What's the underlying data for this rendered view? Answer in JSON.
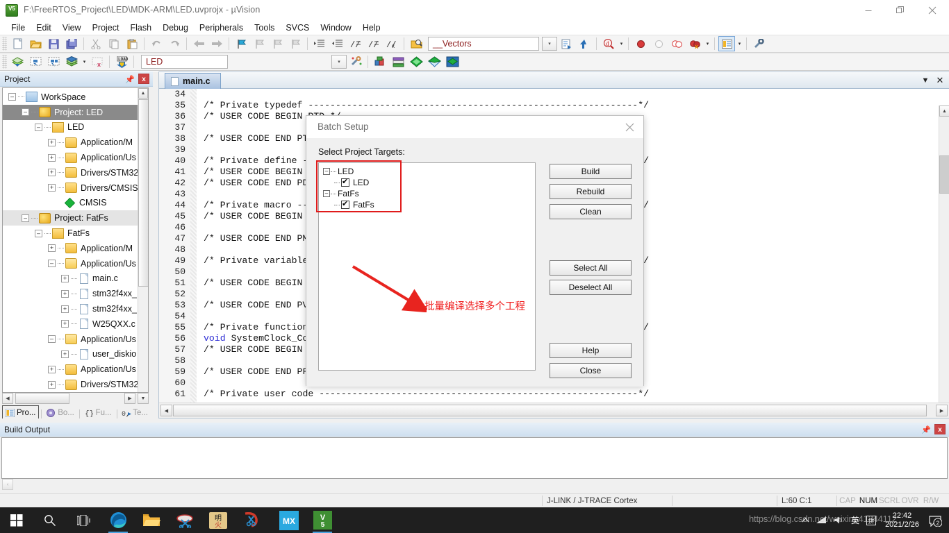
{
  "window": {
    "title": "F:\\FreeRTOS_Project\\LED\\MDK-ARM\\LED.uvprojx - µVision",
    "app_icon": "uvision-v5-icon",
    "minimize": "minimize-icon",
    "maximize": "restore-icon",
    "close": "close-icon"
  },
  "menu": {
    "items": [
      {
        "label": "File"
      },
      {
        "label": "Edit"
      },
      {
        "label": "View"
      },
      {
        "label": "Project"
      },
      {
        "label": "Flash"
      },
      {
        "label": "Debug"
      },
      {
        "label": "Peripherals"
      },
      {
        "label": "Tools"
      },
      {
        "label": "SVCS"
      },
      {
        "label": "Window"
      },
      {
        "label": "Help"
      }
    ]
  },
  "toolbar_main": {
    "icons": [
      "new-file-icon",
      "open-file-icon",
      "save-icon",
      "save-all-icon",
      "cut-icon",
      "copy-icon",
      "paste-icon",
      "undo-icon",
      "redo-icon",
      "navigate-back-icon",
      "navigate-forward-icon",
      "bookmark-toggle-icon",
      "bookmark-prev-icon",
      "bookmark-next-icon",
      "bookmark-clear-icon",
      "indent-icon",
      "outdent-icon",
      "comment-icon",
      "uncomment-icon",
      "find-in-files-icon"
    ],
    "vectors_combo": "__Vectors",
    "after_combo_icons": [
      "browse-symbol-icon",
      "goto-definition-icon",
      "find-next-icon",
      "insert-breakpoint-icon",
      "disable-breakpoint-icon",
      "disable-all-breakpoints-icon",
      "kill-all-breakpoints-icon",
      "manage-windows-icon",
      "configuration-wizard-icon"
    ]
  },
  "toolbar_build": {
    "icons": [
      "translate-icon",
      "build-icon",
      "rebuild-icon",
      "batch-build-icon",
      "stop-build-icon",
      "download-icon"
    ],
    "target_combo": "LED",
    "right_icons": [
      "target-options-icon",
      "manage-run-time-env-icon",
      "manage-project-items-icon",
      "multi-project-icon",
      "pack-installer-icon"
    ]
  },
  "project_panel": {
    "title": "Project",
    "pin_icon": "pin-icon",
    "close_icon": "close-icon",
    "tree": [
      {
        "label": "WorkSpace",
        "indent": 0,
        "icon": "workspace-icon",
        "expander": "-",
        "state": "normal"
      },
      {
        "label": "Project: LED",
        "indent": 1,
        "icon": "project-icon",
        "expander": "-",
        "state": "selected-dark"
      },
      {
        "label": "LED",
        "indent": 2,
        "icon": "target-icon",
        "expander": "-",
        "state": "normal"
      },
      {
        "label": "Application/M",
        "indent": 3,
        "icon": "folder-icon",
        "expander": "+",
        "state": "normal"
      },
      {
        "label": "Application/Us",
        "indent": 3,
        "icon": "folder-icon",
        "expander": "+",
        "state": "normal"
      },
      {
        "label": "Drivers/STM32",
        "indent": 3,
        "icon": "folder-icon",
        "expander": "+",
        "state": "normal"
      },
      {
        "label": "Drivers/CMSIS",
        "indent": 3,
        "icon": "folder-icon",
        "expander": "+",
        "state": "normal"
      },
      {
        "label": "CMSIS",
        "indent": 3,
        "icon": "cmsis-icon",
        "expander": "",
        "state": "normal"
      },
      {
        "label": "Project: FatFs",
        "indent": 1,
        "icon": "project-icon",
        "expander": "-",
        "state": "selected-light"
      },
      {
        "label": "FatFs",
        "indent": 2,
        "icon": "target-icon",
        "expander": "-",
        "state": "normal"
      },
      {
        "label": "Application/M",
        "indent": 3,
        "icon": "folder-icon",
        "expander": "+",
        "state": "normal"
      },
      {
        "label": "Application/Us",
        "indent": 3,
        "icon": "folder-open-icon",
        "expander": "-",
        "state": "normal"
      },
      {
        "label": "main.c",
        "indent": 4,
        "icon": "c-file-icon",
        "expander": "+",
        "state": "normal"
      },
      {
        "label": "stm32f4xx_",
        "indent": 4,
        "icon": "c-file-icon",
        "expander": "+",
        "state": "normal"
      },
      {
        "label": "stm32f4xx_",
        "indent": 4,
        "icon": "c-file-icon",
        "expander": "+",
        "state": "normal"
      },
      {
        "label": "W25QXX.c",
        "indent": 4,
        "icon": "c-file-icon",
        "expander": "+",
        "state": "normal"
      },
      {
        "label": "Application/Us",
        "indent": 3,
        "icon": "folder-open-icon",
        "expander": "-",
        "state": "normal"
      },
      {
        "label": "user_diskio",
        "indent": 4,
        "icon": "c-file-icon",
        "expander": "+",
        "state": "normal"
      },
      {
        "label": "Application/Us",
        "indent": 3,
        "icon": "folder-icon",
        "expander": "+",
        "state": "normal"
      },
      {
        "label": "Drivers/STM32",
        "indent": 3,
        "icon": "folder-icon",
        "expander": "+",
        "state": "normal"
      }
    ],
    "tabs": [
      {
        "label": "Pro...",
        "icon": "project-tab-icon",
        "active": true
      },
      {
        "label": "Bo...",
        "icon": "books-tab-icon",
        "active": false
      },
      {
        "label": "Fu...",
        "icon": "functions-tab-icon",
        "active": false
      },
      {
        "label": "Te...",
        "icon": "templates-tab-icon",
        "active": false
      }
    ]
  },
  "editor": {
    "tab": {
      "label": "main.c",
      "icon": "c-file-icon"
    },
    "dropdown_icon": "chevron-down-icon",
    "close_icon": "close-icon",
    "lines": [
      {
        "num": "34",
        "text": "",
        "cls": ""
      },
      {
        "num": "35",
        "text": "/* Private typedef ------------------------------------------------------------*/",
        "cls": "cmt"
      },
      {
        "num": "36",
        "text": "/* USER CODE BEGIN PTD */",
        "cls": "cmt"
      },
      {
        "num": "37",
        "text": "",
        "cls": ""
      },
      {
        "num": "38",
        "text": "/* USER CODE END PTD */",
        "cls": "cmt"
      },
      {
        "num": "39",
        "text": "",
        "cls": ""
      },
      {
        "num": "40",
        "text": "/* Private define -------------------------------------------------------------*/",
        "cls": "cmt"
      },
      {
        "num": "41",
        "text": "/* USER CODE BEGIN PD */",
        "cls": "cmt"
      },
      {
        "num": "42",
        "text": "/* USER CODE END PD */",
        "cls": "cmt"
      },
      {
        "num": "43",
        "text": "",
        "cls": ""
      },
      {
        "num": "44",
        "text": "/* Private macro --------------------------------------------------------------*/",
        "cls": "cmt"
      },
      {
        "num": "45",
        "text": "/* USER CODE BEGIN PM */",
        "cls": "cmt"
      },
      {
        "num": "46",
        "text": "",
        "cls": ""
      },
      {
        "num": "47",
        "text": "/* USER CODE END PM */",
        "cls": "cmt"
      },
      {
        "num": "48",
        "text": "",
        "cls": ""
      },
      {
        "num": "49",
        "text": "/* Private variables ----------------------------------------------------------*/",
        "cls": "cmt"
      },
      {
        "num": "50",
        "text": "",
        "cls": ""
      },
      {
        "num": "51",
        "text": "/* USER CODE BEGIN PV */",
        "cls": "cmt"
      },
      {
        "num": "52",
        "text": "",
        "cls": ""
      },
      {
        "num": "53",
        "text": "/* USER CODE END PV */",
        "cls": "cmt"
      },
      {
        "num": "54",
        "text": "",
        "cls": ""
      },
      {
        "num": "55",
        "text": "/* Private function prototypes ------------------------------------------------*/",
        "cls": "cmt"
      },
      {
        "num": "56",
        "text": "void SystemClock_Config(void);",
        "cls": "kwline"
      },
      {
        "num": "57",
        "text": "/* USER CODE BEGIN PFP */",
        "cls": "cmt"
      },
      {
        "num": "58",
        "text": "",
        "cls": ""
      },
      {
        "num": "59",
        "text": "/* USER CODE END PFP */",
        "cls": "cmt"
      },
      {
        "num": "60",
        "text": "",
        "cls": ""
      },
      {
        "num": "61",
        "text": "/* Private user code ----------------------------------------------------------*/",
        "cls": "cmt"
      }
    ]
  },
  "dialog": {
    "title": "Batch Setup",
    "close_icon": "close-icon",
    "label": "Select Project Targets:",
    "targets": [
      {
        "name": "LED",
        "type": "project",
        "expander": "-"
      },
      {
        "name": "LED",
        "type": "target",
        "checked": true
      },
      {
        "name": "FatFs",
        "type": "project",
        "expander": "-"
      },
      {
        "name": "FatFs",
        "type": "target",
        "checked": true
      }
    ],
    "annotation": "批量编译选择多个工程",
    "annotation_color": "#f01d1d",
    "buttons_top": [
      {
        "label": "Build"
      },
      {
        "label": "Rebuild"
      },
      {
        "label": "Clean"
      }
    ],
    "buttons_mid": [
      {
        "label": "Select All"
      },
      {
        "label": "Deselect All"
      }
    ],
    "buttons_bottom": [
      {
        "label": "Help"
      },
      {
        "label": "Close"
      }
    ]
  },
  "build_output": {
    "title": "Build Output",
    "pin_icon": "pin-icon",
    "close_icon": "close-icon",
    "content": ""
  },
  "statusbar": {
    "debugger": "J-LINK / J-TRACE Cortex",
    "cursor": "L:60 C:1",
    "flags": [
      {
        "label": "CAP",
        "on": false
      },
      {
        "label": "NUM",
        "on": true
      },
      {
        "label": "SCRL",
        "on": false
      },
      {
        "label": "OVR",
        "on": false
      },
      {
        "label": "R/W",
        "on": false
      }
    ]
  },
  "taskbar": {
    "items": [
      {
        "name": "start-button",
        "icon": "windows-logo-icon",
        "running": false
      },
      {
        "name": "search-button",
        "icon": "search-icon",
        "running": false
      },
      {
        "name": "task-view-button",
        "icon": "task-view-icon",
        "running": false
      },
      {
        "name": "edge-button",
        "icon": "edge-browser-icon",
        "running": true
      },
      {
        "name": "explorer-button",
        "icon": "file-explorer-icon",
        "running": false
      },
      {
        "name": "snipping-button",
        "icon": "snipping-tool-icon",
        "running": false
      },
      {
        "name": "app-button",
        "icon": "mingxiao-app-icon",
        "running": false
      },
      {
        "name": "capture-button",
        "icon": "screen-capture-icon",
        "running": false
      },
      {
        "name": "cubemx-button",
        "icon": "stm32cubemx-icon",
        "running": false
      },
      {
        "name": "uvision-button",
        "icon": "uvision-v5-icon",
        "running": true
      }
    ],
    "tray": {
      "show_hidden": "chevron-up-icon",
      "items": [
        "network-icon",
        "volume-icon",
        "ime-chinese-icon",
        "ime-pinyin-icon"
      ],
      "time": "22:42",
      "date": "2021/2/26",
      "action_center": "notifications-icon",
      "badge": "2"
    },
    "watermark": "https://blog.csdn.net/weixin_41344112"
  }
}
